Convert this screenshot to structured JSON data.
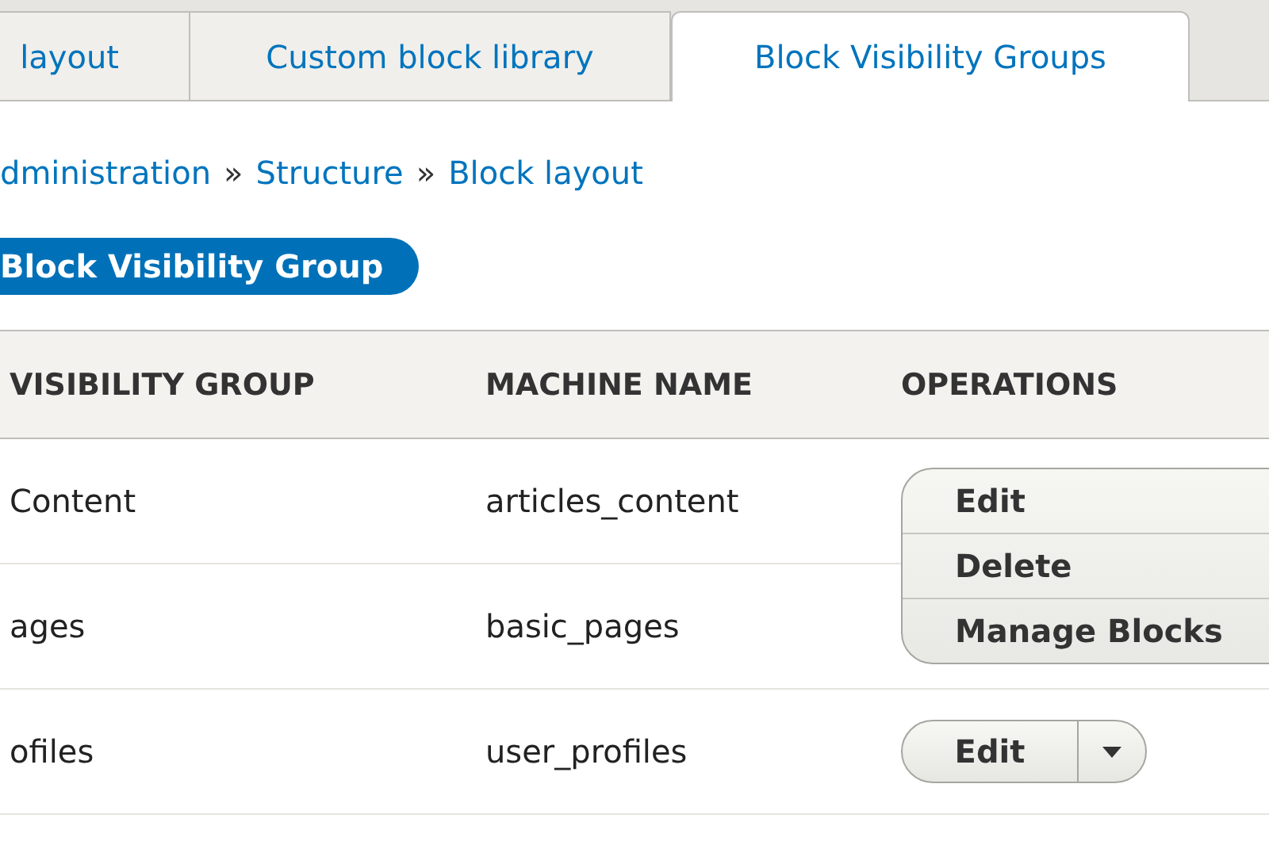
{
  "tabs": [
    {
      "label": "layout",
      "selected": false
    },
    {
      "label": "Custom block library",
      "selected": false
    },
    {
      "label": "Block Visibility Groups",
      "selected": true
    }
  ],
  "breadcrumb": [
    "dministration",
    "Structure",
    "Block layout"
  ],
  "breadcrumb_separator": "»",
  "action_button": "Block Visibility Group",
  "table": {
    "columns": [
      "VISIBILITY GROUP",
      "MACHINE NAME",
      "OPERATIONS"
    ],
    "rows": [
      {
        "label": "Content",
        "machine_name": "articles_content",
        "operations": {
          "primary": "Edit",
          "expanded": true,
          "items": [
            "Delete",
            "Manage Blocks"
          ]
        }
      },
      {
        "label": "ages",
        "machine_name": "basic_pages"
      },
      {
        "label": "ofiles",
        "machine_name": "user_profiles",
        "operations": {
          "primary": "Edit",
          "expanded": false
        }
      }
    ]
  }
}
